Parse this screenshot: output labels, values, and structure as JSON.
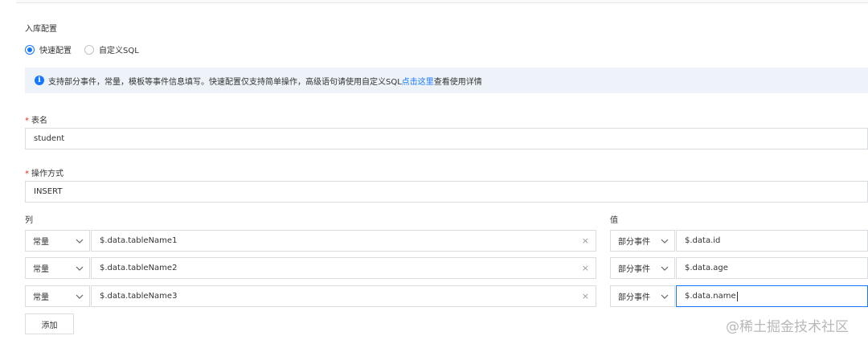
{
  "section": {
    "title": "入库配置"
  },
  "mode": {
    "options": [
      {
        "label": "快速配置",
        "checked": true
      },
      {
        "label": "自定义SQL",
        "checked": false
      }
    ]
  },
  "alert": {
    "icon": "info-icon",
    "text": "支持部分事件，常量，模板等事件信息填写。快速配置仅支持简单操作，高级语句请使用自定义SQL",
    "link": "点击这里",
    "suffix": "查看使用详情"
  },
  "table_name": {
    "label": "表名",
    "value": "student"
  },
  "operation": {
    "label": "操作方式",
    "value": "INSERT"
  },
  "columns": {
    "left_header": "列",
    "right_header": "值",
    "rows": [
      {
        "left_type": "常量",
        "left_value": "$.data.tableName1",
        "right_type": "部分事件",
        "right_value": "$.data.id"
      },
      {
        "left_type": "常量",
        "left_value": "$.data.tableName2",
        "right_type": "部分事件",
        "right_value": "$.data.age"
      },
      {
        "left_type": "常量",
        "left_value": "$.data.tableName3",
        "right_type": "部分事件",
        "right_value": "$.data.name"
      }
    ]
  },
  "add_button": "添加",
  "watermark": "@稀土掘金技术社区",
  "colors": {
    "accent": "#1677ff",
    "required": "#e0301e",
    "alert_bg": "#eef3f9",
    "border": "#d9dce1"
  }
}
